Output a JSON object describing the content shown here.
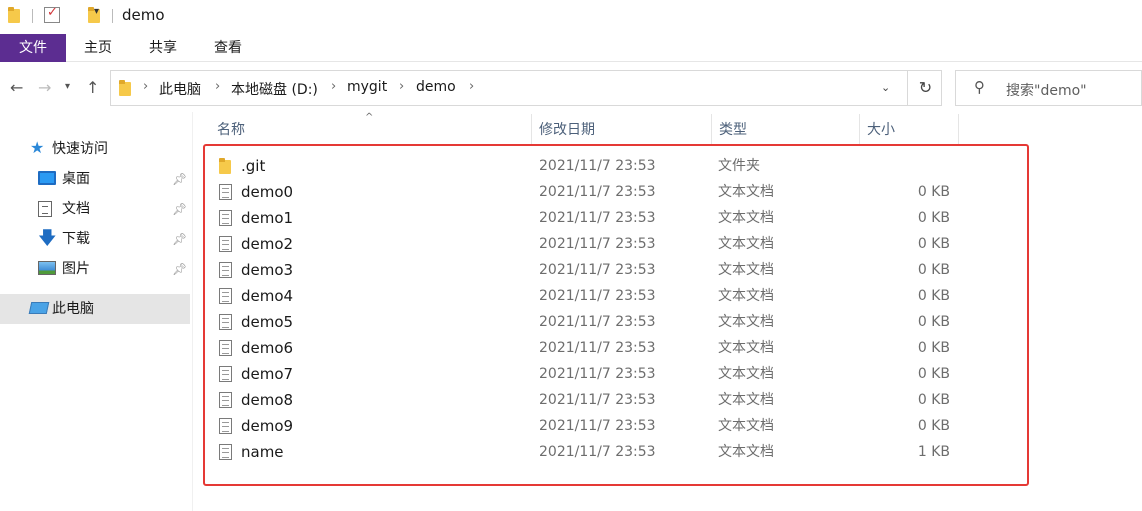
{
  "window": {
    "title": "demo"
  },
  "ribbon": {
    "tabs": [
      "文件",
      "主页",
      "共享",
      "查看"
    ]
  },
  "address": {
    "crumbs": [
      "此电脑",
      "本地磁盘 (D:)",
      "mygit",
      "demo"
    ]
  },
  "search": {
    "placeholder": "搜索\"demo\""
  },
  "nav": {
    "quick_access": "快速访问",
    "items": [
      {
        "label": "桌面",
        "icon": "desktop-icon"
      },
      {
        "label": "文档",
        "icon": "documents-icon"
      },
      {
        "label": "下载",
        "icon": "downloads-icon"
      },
      {
        "label": "图片",
        "icon": "pictures-icon"
      }
    ],
    "this_pc": "此电脑"
  },
  "columns": {
    "name": "名称",
    "modified": "修改日期",
    "type": "类型",
    "size": "大小"
  },
  "files": [
    {
      "name": ".git",
      "modified": "2021/11/7 23:53",
      "type": "文件夹",
      "size": "",
      "icon": "folder-icon"
    },
    {
      "name": "demo0",
      "modified": "2021/11/7 23:53",
      "type": "文本文档",
      "size": "0 KB",
      "icon": "text-file-icon"
    },
    {
      "name": "demo1",
      "modified": "2021/11/7 23:53",
      "type": "文本文档",
      "size": "0 KB",
      "icon": "text-file-icon"
    },
    {
      "name": "demo2",
      "modified": "2021/11/7 23:53",
      "type": "文本文档",
      "size": "0 KB",
      "icon": "text-file-icon"
    },
    {
      "name": "demo3",
      "modified": "2021/11/7 23:53",
      "type": "文本文档",
      "size": "0 KB",
      "icon": "text-file-icon"
    },
    {
      "name": "demo4",
      "modified": "2021/11/7 23:53",
      "type": "文本文档",
      "size": "0 KB",
      "icon": "text-file-icon"
    },
    {
      "name": "demo5",
      "modified": "2021/11/7 23:53",
      "type": "文本文档",
      "size": "0 KB",
      "icon": "text-file-icon"
    },
    {
      "name": "demo6",
      "modified": "2021/11/7 23:53",
      "type": "文本文档",
      "size": "0 KB",
      "icon": "text-file-icon"
    },
    {
      "name": "demo7",
      "modified": "2021/11/7 23:53",
      "type": "文本文档",
      "size": "0 KB",
      "icon": "text-file-icon"
    },
    {
      "name": "demo8",
      "modified": "2021/11/7 23:53",
      "type": "文本文档",
      "size": "0 KB",
      "icon": "text-file-icon"
    },
    {
      "name": "demo9",
      "modified": "2021/11/7 23:53",
      "type": "文本文档",
      "size": "0 KB",
      "icon": "text-file-icon"
    },
    {
      "name": "name",
      "modified": "2021/11/7 23:53",
      "type": "文本文档",
      "size": "1 KB",
      "icon": "text-file-icon"
    }
  ],
  "colors": {
    "file_tab": "#5c2d91",
    "highlight_box": "#e53935",
    "selected_nav": "#e5e5e5"
  }
}
